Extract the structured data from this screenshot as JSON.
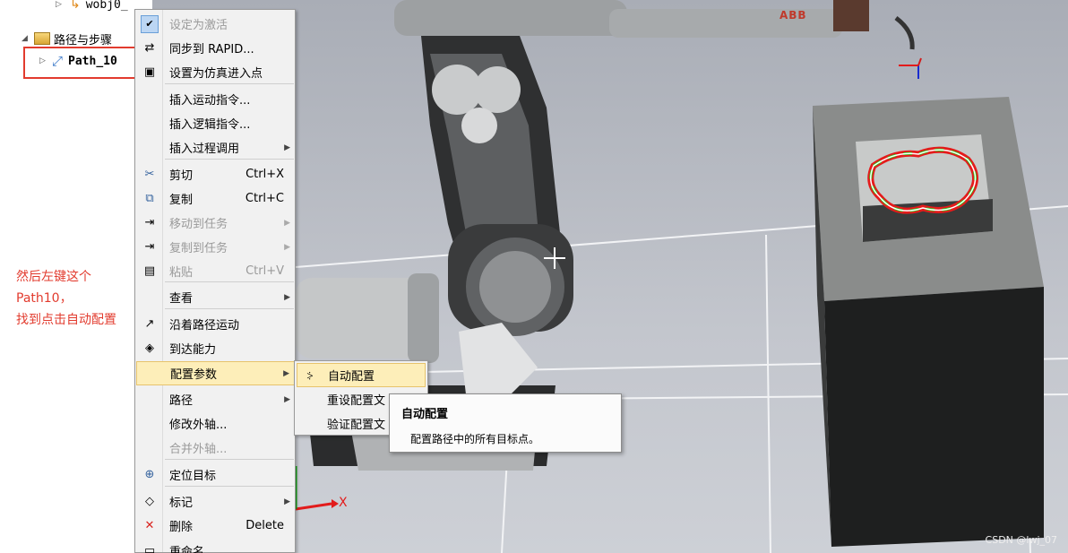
{
  "tree": {
    "partial_item": "wobj0_",
    "steps_node": "路径与步骤",
    "path_node": "Path_10"
  },
  "context_menu": {
    "items": [
      {
        "label": "设定为激活",
        "shortcut": "",
        "disabled": true,
        "submenu": false,
        "icon": "check-icon"
      },
      {
        "label": "同步到 RAPID...",
        "shortcut": "",
        "disabled": false,
        "submenu": false,
        "icon": "sync-icon"
      },
      {
        "label": "设置为仿真进入点",
        "shortcut": "",
        "disabled": false,
        "submenu": false,
        "icon": "entry-point-icon"
      },
      {
        "label": "插入运动指令...",
        "shortcut": "",
        "disabled": false,
        "submenu": false,
        "icon": ""
      },
      {
        "label": "插入逻辑指令...",
        "shortcut": "",
        "disabled": false,
        "submenu": false,
        "icon": ""
      },
      {
        "label": "插入过程调用",
        "shortcut": "",
        "disabled": false,
        "submenu": true,
        "icon": ""
      },
      {
        "label": "剪切",
        "shortcut": "Ctrl+X",
        "disabled": false,
        "submenu": false,
        "icon": "scissors-icon"
      },
      {
        "label": "复制",
        "shortcut": "Ctrl+C",
        "disabled": false,
        "submenu": false,
        "icon": "copy-icon"
      },
      {
        "label": "移动到任务",
        "shortcut": "",
        "disabled": true,
        "submenu": true,
        "icon": "move-icon"
      },
      {
        "label": "复制到任务",
        "shortcut": "",
        "disabled": true,
        "submenu": true,
        "icon": "copy-task-icon"
      },
      {
        "label": "粘贴",
        "shortcut": "Ctrl+V",
        "disabled": true,
        "submenu": false,
        "icon": "paste-icon"
      },
      {
        "label": "查看",
        "shortcut": "",
        "disabled": false,
        "submenu": true,
        "icon": ""
      },
      {
        "label": "沿着路径运动",
        "shortcut": "",
        "disabled": false,
        "submenu": false,
        "icon": "move-along-path-icon"
      },
      {
        "label": "到达能力",
        "shortcut": "",
        "disabled": false,
        "submenu": false,
        "icon": "reachability-icon"
      },
      {
        "label": "配置参数",
        "shortcut": "",
        "disabled": false,
        "submenu": true,
        "icon": ""
      },
      {
        "label": "路径",
        "shortcut": "",
        "disabled": false,
        "submenu": true,
        "icon": ""
      },
      {
        "label": "修改外轴...",
        "shortcut": "",
        "disabled": false,
        "submenu": false,
        "icon": ""
      },
      {
        "label": "合并外轴...",
        "shortcut": "",
        "disabled": true,
        "submenu": false,
        "icon": ""
      },
      {
        "label": "定位目标",
        "shortcut": "",
        "disabled": false,
        "submenu": false,
        "icon": "locate-icon"
      },
      {
        "label": "标记",
        "shortcut": "",
        "disabled": false,
        "submenu": true,
        "icon": "tag-icon"
      },
      {
        "label": "删除",
        "shortcut": "Delete",
        "disabled": false,
        "submenu": false,
        "icon": "delete-icon"
      },
      {
        "label": "重命名",
        "shortcut": "",
        "disabled": false,
        "submenu": false,
        "icon": "rename-icon"
      }
    ]
  },
  "submenu": {
    "items": [
      {
        "label": "自动配置"
      },
      {
        "label": "重设配置文"
      },
      {
        "label": "验证配置文"
      }
    ]
  },
  "tooltip": {
    "title": "自动配置",
    "text": "配置路径中的所有目标点。"
  },
  "annotation": {
    "line1": "然后左键这个",
    "line2": "Path10，",
    "line3": "找到点击自动配置"
  },
  "viewport": {
    "brand_text": "ABB",
    "axis_x_label": "X"
  },
  "watermark": "CSDN @lwj_07",
  "colors": {
    "accent_red": "#e23b2e",
    "highlight": "#fdeeb9"
  }
}
